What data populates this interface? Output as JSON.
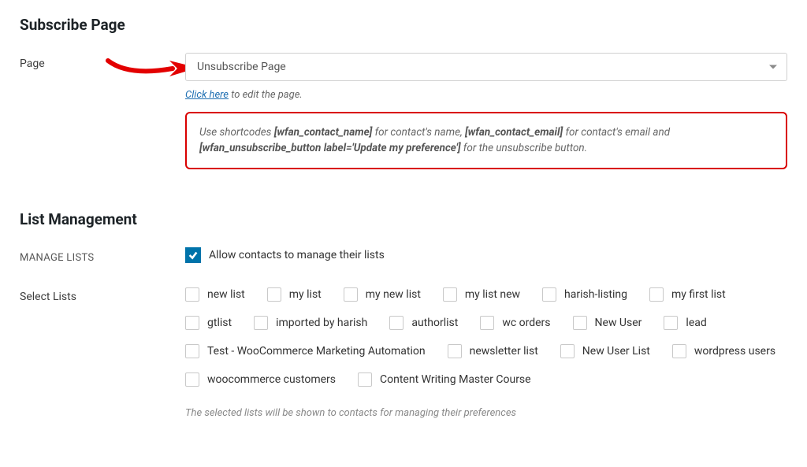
{
  "subscribe": {
    "title": "Subscribe Page",
    "page_label": "Page",
    "select_value": "Unsubscribe Page",
    "click_here": "Click here",
    "click_here_suffix": " to edit the page.",
    "shortcode_box": {
      "prefix": "Use shortcodes ",
      "code1": "[wfan_contact_name]",
      "mid1": " for contact's name, ",
      "code2": "[wfan_contact_email]",
      "mid2": " for contact's email and ",
      "code3": "[wfan_unsubscribe_button label='Update my preference']",
      "suffix": " for the unsubscribe button."
    }
  },
  "list_management": {
    "title": "List Management",
    "manage_lists_label": "MANAGE LISTS",
    "allow_label": "Allow contacts to manage their lists",
    "select_lists_label": "Select Lists",
    "lists": [
      "new list",
      "my list",
      "my new list",
      "my list new",
      "harish-listing",
      "my first list",
      "gtlist",
      "imported by harish",
      "authorlist",
      "wc orders",
      "New User",
      "lead",
      "Test - WooCommerce Marketing Automation",
      "newsletter list",
      "New User List",
      "wordpress users",
      "woocommerce customers",
      "Content Writing Master Course"
    ],
    "footer_hint": "The selected lists will be shown to contacts for managing their preferences"
  }
}
